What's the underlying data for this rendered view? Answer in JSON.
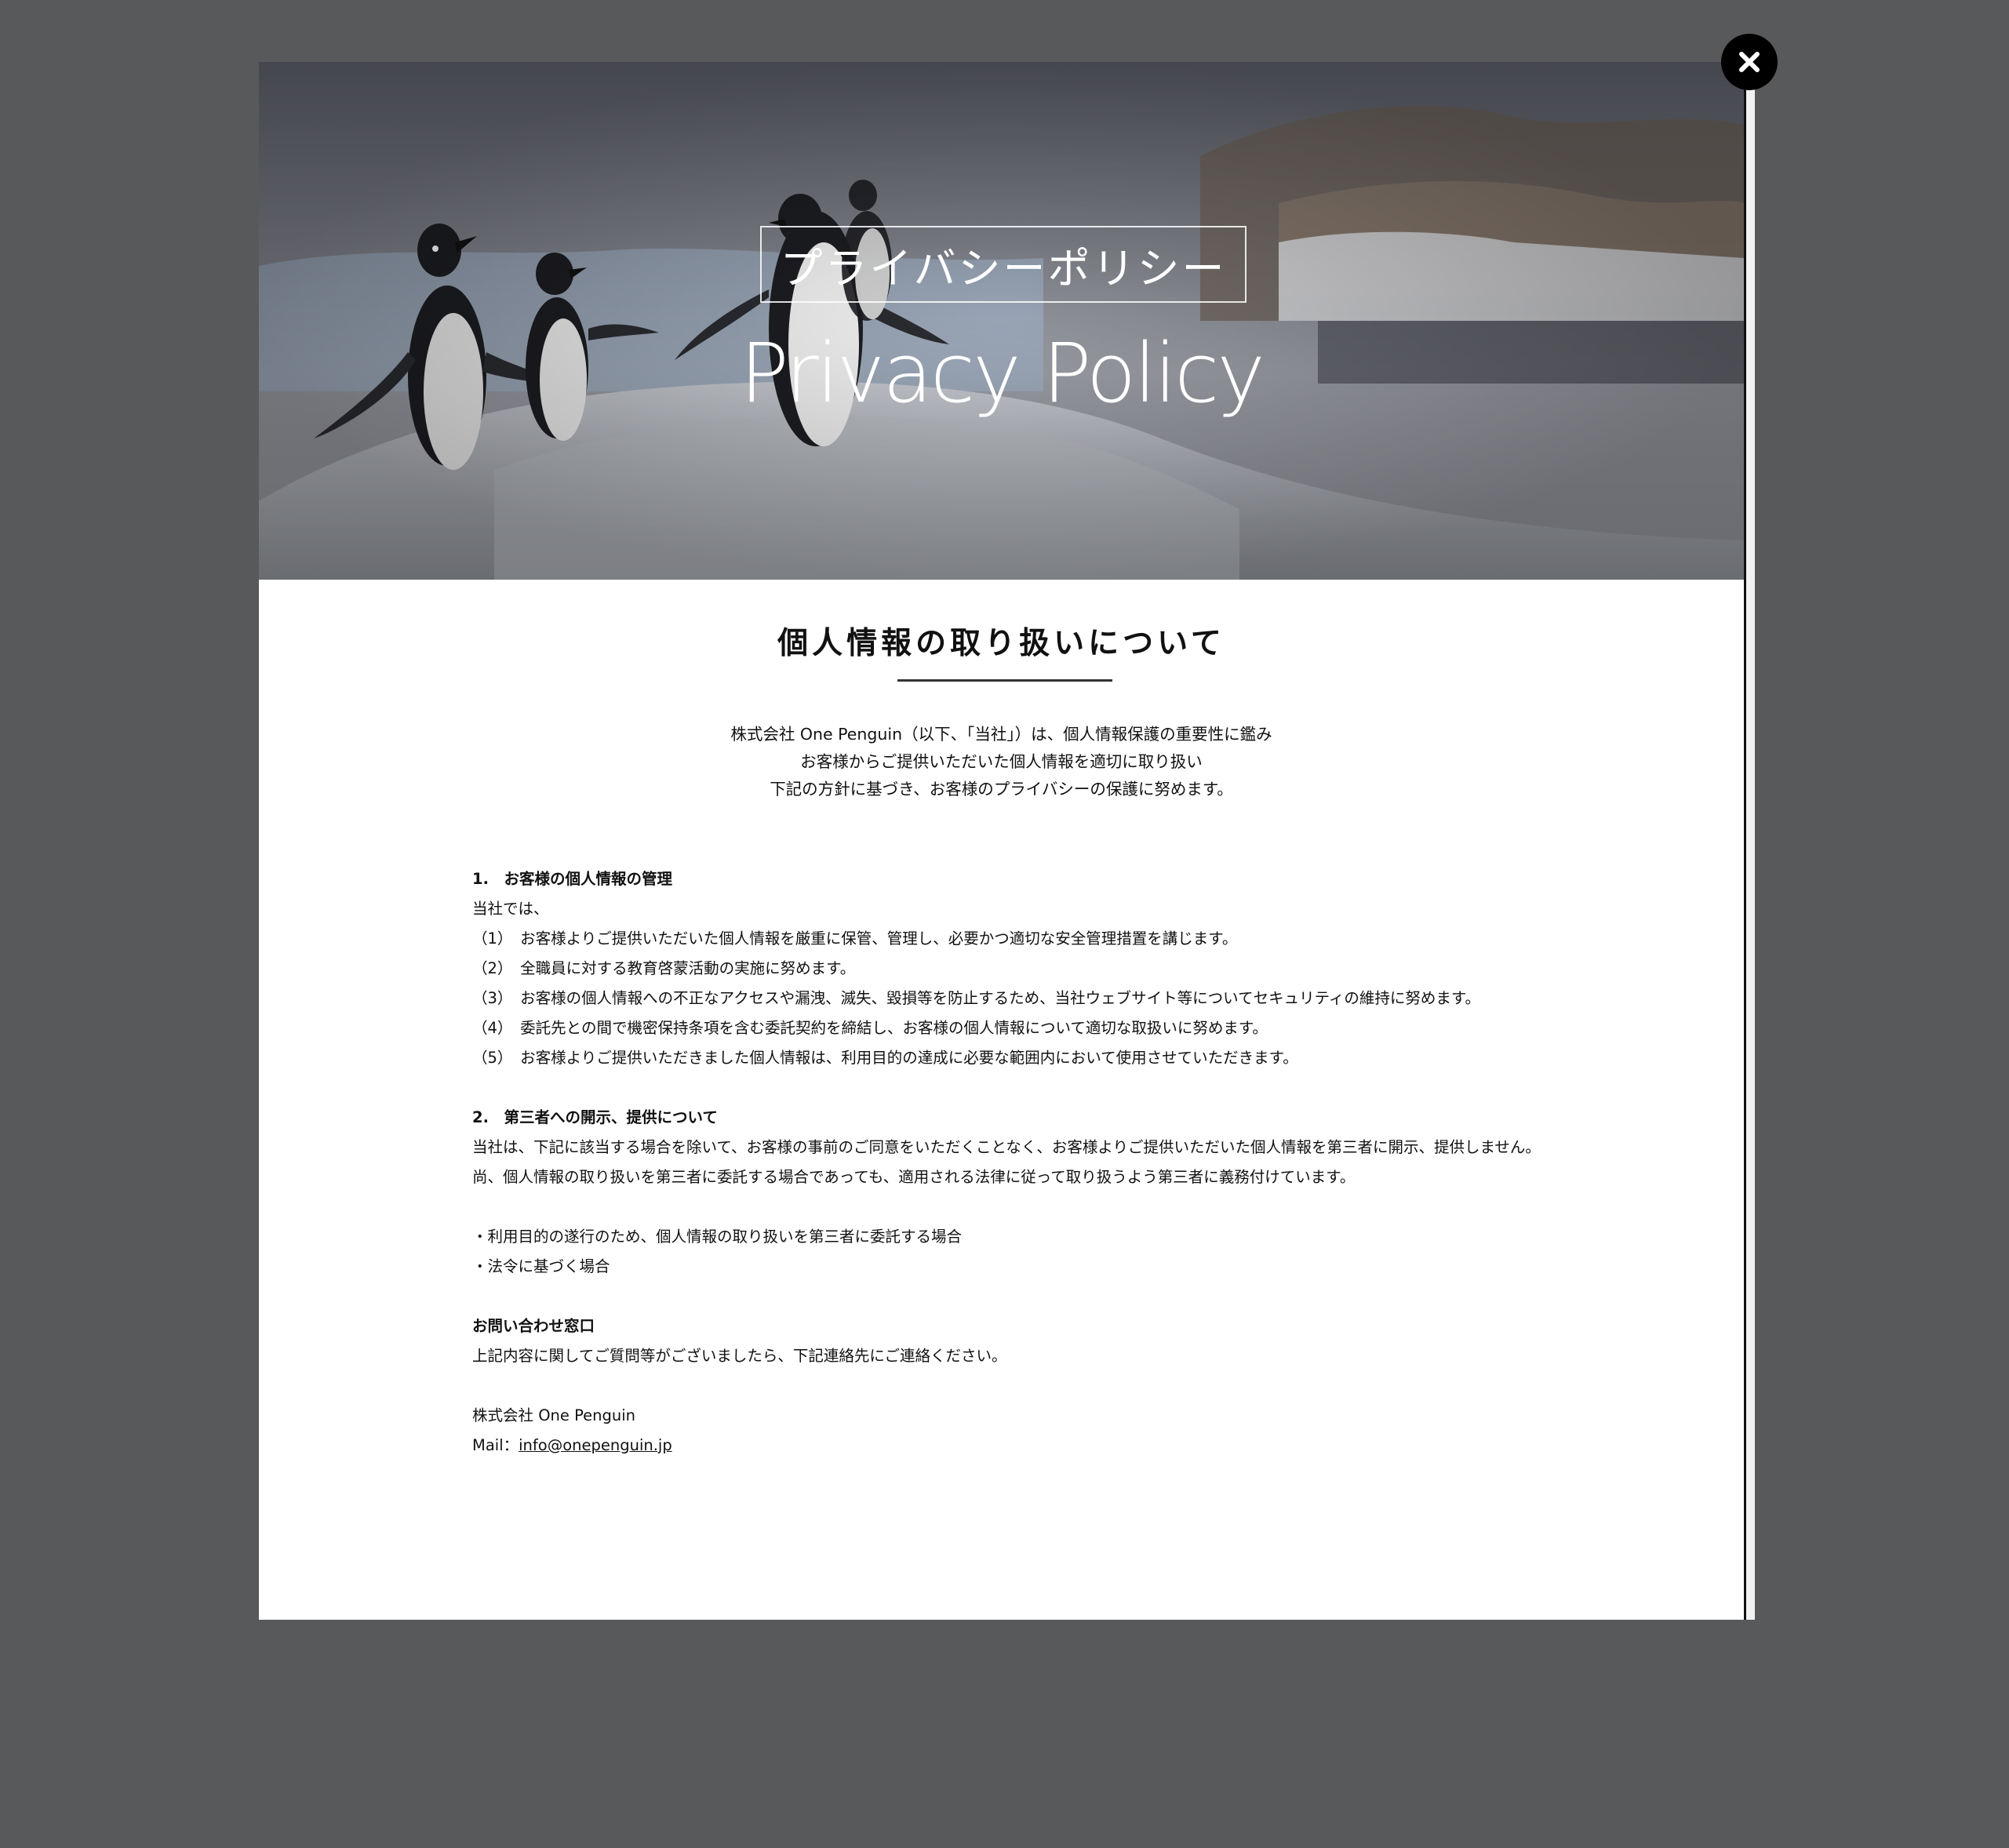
{
  "hero": {
    "title_jp": "プライバシーポリシー",
    "title_en": "Privacy Policy"
  },
  "close_icon": "close-x-icon",
  "content": {
    "title": "個人情報の取り扱いについて",
    "intro": [
      "株式会社 One Penguin（以下、「当社」）は、個人情報保護の重要性に鑑み",
      "お客様からご提供いただいた個人情報を適切に取り扱い",
      "下記の方針に基づき、お客様のプライバシーの保護に努めます。"
    ],
    "section1": {
      "heading": "1.　お客様の個人情報の管理",
      "lead": "当社では、",
      "items": [
        "（1）　お客様よりご提供いただいた個人情報を厳重に保管、管理し、必要かつ適切な安全管理措置を講じます。",
        "（2）　全職員に対する教育啓蒙活動の実施に努めます。",
        "（3）　お客様の個人情報への不正なアクセスや漏洩、滅失、毀損等を防止するため、当社ウェブサイト等についてセキュリティの維持に努めます。",
        "（4）　委託先との間で機密保持条項を含む委託契約を締結し、お客様の個人情報について適切な取扱いに努めます。",
        "（5）　お客様よりご提供いただきました個人情報は、利用目的の達成に必要な範囲内において使用させていただきます。"
      ]
    },
    "section2": {
      "heading": "2.　第三者への開示、提供について",
      "paragraphs": [
        "当社は、下記に該当する場合を除いて、お客様の事前のご同意をいただくことなく、お客様よりご提供いただいた個人情報を第三者に開示、提供しません。",
        "尚、個人情報の取り扱いを第三者に委託する場合であっても、適用される法律に従って取り扱うよう第三者に義務付けています。"
      ],
      "bullets": [
        "・利用目的の遂行のため、個人情報の取り扱いを第三者に委託する場合",
        "・法令に基づく場合"
      ]
    },
    "contact": {
      "heading": "お問い合わせ窓口",
      "text": "上記内容に関してご質問等がございましたら、下記連絡先にご連絡ください。",
      "company": "株式会社 One Penguin",
      "mail_label": "Mail：",
      "mail": "info@onepenguin.jp"
    }
  }
}
